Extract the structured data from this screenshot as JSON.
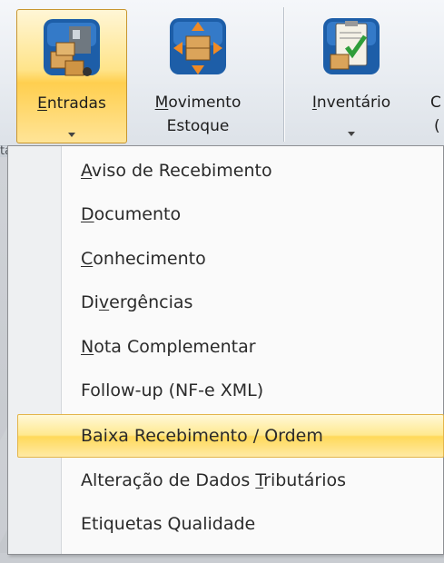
{
  "ribbon": {
    "buttons": [
      {
        "label_line1": "Entradas",
        "accel": "E",
        "icon": "truck-boxes-icon",
        "has_dropdown": true
      },
      {
        "label_line1": "Movimento",
        "label_line2": "Estoque",
        "accel": "M",
        "icon": "boxes-arrows-icon",
        "has_dropdown": false
      },
      {
        "label_line1": "Inventário",
        "accel": "I",
        "icon": "clipboard-check-icon",
        "has_dropdown": true
      },
      {
        "label_line1": "C",
        "label_line2": "(",
        "icon": "cut-off-icon"
      }
    ],
    "group_label": "ta"
  },
  "menu": {
    "items": [
      {
        "pre": "",
        "accel": "A",
        "post": "viso de Recebimento"
      },
      {
        "pre": "",
        "accel": "D",
        "post": "ocumento"
      },
      {
        "pre": "",
        "accel": "C",
        "post": "onhecimento"
      },
      {
        "pre": "Di",
        "accel": "v",
        "post": "ergências"
      },
      {
        "pre": "",
        "accel": "N",
        "post": "ota Complementar"
      },
      {
        "pre": "Follow-up (NF-e XML)",
        "accel": "",
        "post": ""
      },
      {
        "pre": "Baixa Recebimento / Ordem",
        "accel": "",
        "post": "",
        "highlighted": true
      },
      {
        "pre": "Alteração de Dados ",
        "accel": "T",
        "post": "ributários"
      },
      {
        "pre": "Etiquetas Qualidade",
        "accel": "",
        "post": ""
      }
    ]
  },
  "colors": {
    "active_button": "#ffe48a",
    "highlight_item": "#ffe98f",
    "menu_bg": "#fafafa"
  }
}
